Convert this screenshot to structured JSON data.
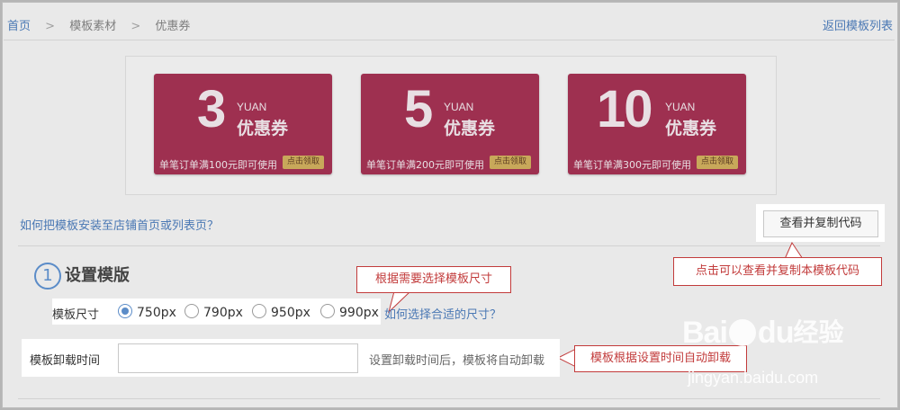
{
  "breadcrumb": {
    "items": [
      "首页",
      "模板素材",
      "优惠券"
    ],
    "separator": ">"
  },
  "back_link": "返回模板列表",
  "coupons": [
    {
      "value": "3",
      "yuan": "YUAN",
      "label": "优惠券",
      "condition": "单笔订单满100元即可使用",
      "button": "点击领取"
    },
    {
      "value": "5",
      "yuan": "YUAN",
      "label": "优惠券",
      "condition": "单笔订单满200元即可使用",
      "button": "点击领取"
    },
    {
      "value": "10",
      "yuan": "YUAN",
      "label": "优惠券",
      "condition": "单笔订单满300元即可使用",
      "button": "点击领取"
    }
  ],
  "install_help_link": "如何把模板安装至店铺首页或列表页？",
  "copy_button": "查看并复制代码",
  "callouts": {
    "copy": "点击可以查看并复制本模板代码",
    "size": "根据需要选择模板尺寸",
    "unload": "模板根据设置时间自动卸载"
  },
  "section": {
    "number": "1",
    "title": "设置模版"
  },
  "size": {
    "label": "模板尺寸",
    "options": [
      "750px",
      "790px",
      "950px",
      "990px"
    ],
    "selected": "750px",
    "help_link": "如何选择合适的尺寸？"
  },
  "unload": {
    "label": "模板卸载时间",
    "value": "",
    "hint": "设置卸载时间后，模板将自动卸载"
  },
  "watermark": {
    "logo": "Bai",
    "logo2": "du",
    "cn": "经验",
    "url": "jingyan.baidu.com"
  },
  "colors": {
    "coupon": "#9e3050",
    "link": "#4a78b4",
    "callout": "#c23b3b",
    "accent": "#5b8cc8"
  }
}
